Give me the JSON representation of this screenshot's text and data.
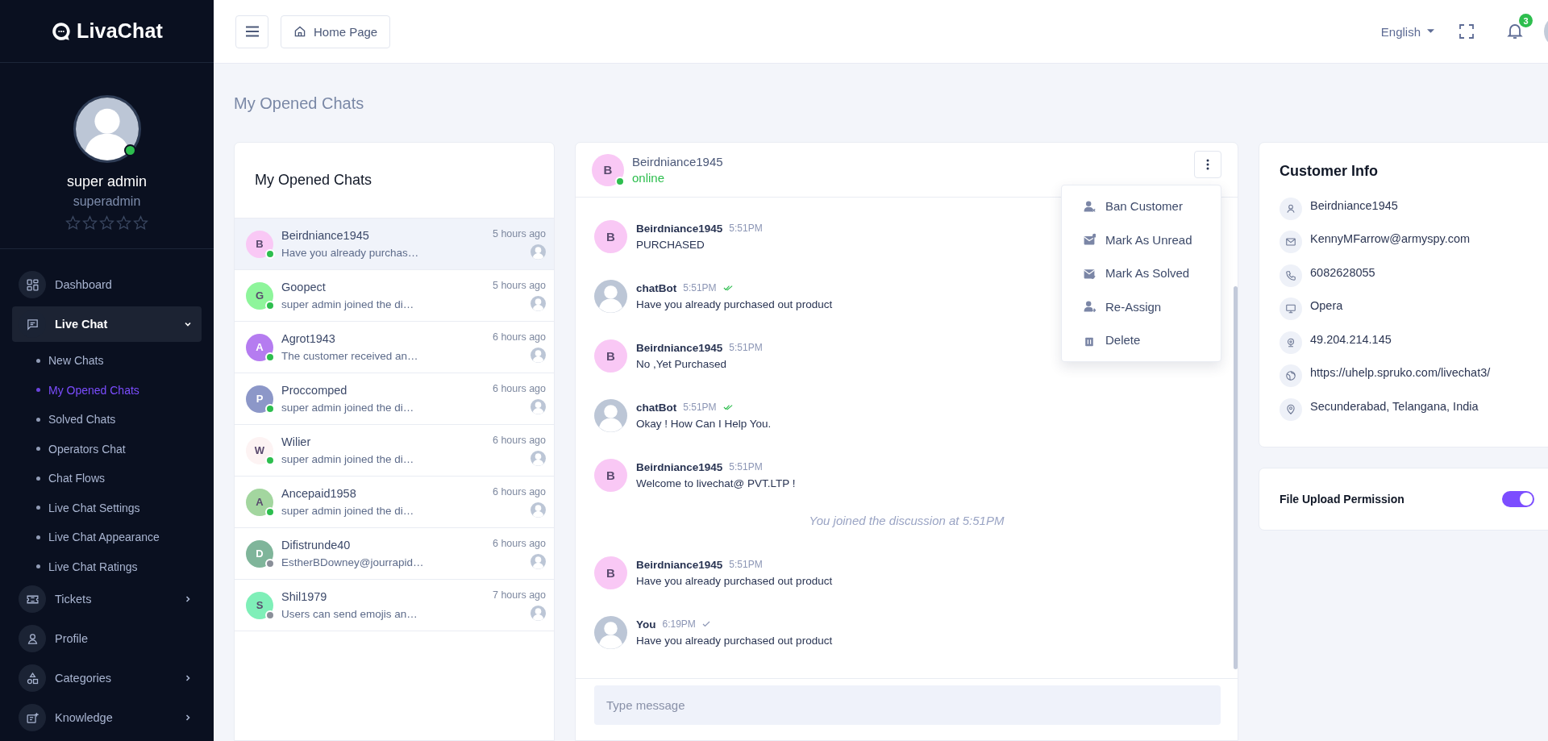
{
  "brand": {
    "name": "LivaChat"
  },
  "sidebar": {
    "user": {
      "name": "super admin",
      "username": "superadmin",
      "online": true,
      "stars": 0
    },
    "menu": [
      {
        "label": "Dashboard",
        "selected": false
      },
      {
        "label": "Live Chat",
        "selected": true,
        "expanded": true,
        "children": [
          {
            "label": "New Chats",
            "selected": false
          },
          {
            "label": "My Opened Chats",
            "selected": true
          },
          {
            "label": "Solved Chats",
            "selected": false
          },
          {
            "label": "Operators Chat",
            "selected": false
          },
          {
            "label": "Chat Flows",
            "selected": false
          },
          {
            "label": "Live Chat Settings",
            "selected": false
          },
          {
            "label": "Live Chat Appearance",
            "selected": false
          },
          {
            "label": "Live Chat Ratings",
            "selected": false
          }
        ]
      },
      {
        "label": "Tickets",
        "selected": false,
        "expanded": false
      },
      {
        "label": "Profile",
        "selected": false
      },
      {
        "label": "Categories",
        "selected": false,
        "expanded": false
      },
      {
        "label": "Knowledge",
        "selected": false,
        "expanded": false
      }
    ]
  },
  "header": {
    "breadcrumb": "Home Page",
    "language": "English",
    "notifications": "3"
  },
  "page_title": "My Opened Chats",
  "chat_list": {
    "title": "My Opened Chats",
    "items": [
      {
        "initial": "B",
        "name": "Beirdniance1945",
        "preview": "Have you already purchas…",
        "time": "5 hours ago",
        "color": "#f9c8f5",
        "online": true,
        "selected": true
      },
      {
        "initial": "G",
        "name": "Goopect",
        "preview": "super admin joined the di…",
        "time": "5 hours ago",
        "color": "#8ef59b",
        "online": true,
        "selected": false
      },
      {
        "initial": "A",
        "name": "Agrot1943",
        "preview": "The customer received an…",
        "time": "6 hours ago",
        "color": "#b57cf0",
        "online": true,
        "selected": false
      },
      {
        "initial": "P",
        "name": "Proccomped",
        "preview": "super admin joined the di…",
        "time": "6 hours ago",
        "color": "#8c97c8",
        "online": true,
        "selected": false
      },
      {
        "initial": "W",
        "name": "Wilier",
        "preview": "super admin joined the di…",
        "time": "6 hours ago",
        "color": "#fdf3f3",
        "online": true,
        "selected": false
      },
      {
        "initial": "A",
        "name": "Ancepaid1958",
        "preview": "super admin joined the di…",
        "time": "6 hours ago",
        "color": "#a3d69f",
        "online": true,
        "selected": false
      },
      {
        "initial": "D",
        "name": "Difistrunde40",
        "preview": "EstherBDowney@jourrapid…",
        "time": "6 hours ago",
        "color": "#7fb59a",
        "online": false,
        "selected": false
      },
      {
        "initial": "S",
        "name": "Shil1979",
        "preview": "Users can send emojis an…",
        "time": "7 hours ago",
        "color": "#7fefb8",
        "online": false,
        "selected": false
      }
    ]
  },
  "conversation": {
    "contact": {
      "initial": "B",
      "name": "Beirdniance1945",
      "status": "online",
      "color": "#f9c8f5",
      "online": true
    },
    "menu_open": true,
    "menu": [
      {
        "label": "Ban Customer"
      },
      {
        "label": "Mark As Unread"
      },
      {
        "label": "Mark As Solved"
      },
      {
        "label": "Re-Assign"
      },
      {
        "label": "Delete"
      }
    ],
    "messages": [
      {
        "kind": "message",
        "initial": "B",
        "sender": "Beirdniance1945",
        "time": "5:51PM",
        "text": "PURCHASED"
      },
      {
        "kind": "message",
        "sender": "chatBot",
        "time": "5:51PM",
        "read": true,
        "text": "Have you already purchased out product"
      },
      {
        "kind": "message",
        "initial": "B",
        "sender": "Beirdniance1945",
        "time": "5:51PM",
        "text": "No ,Yet Purchased"
      },
      {
        "kind": "message",
        "sender": "chatBot",
        "time": "5:51PM",
        "read": true,
        "text": "Okay ! How Can I Help You."
      },
      {
        "kind": "message",
        "initial": "B",
        "sender": "Beirdniance1945",
        "time": "5:51PM",
        "text": "Welcome to livechat@ PVT.LTP !"
      },
      {
        "kind": "system",
        "text": "You joined the discussion at 5:51PM"
      },
      {
        "kind": "message",
        "initial": "B",
        "sender": "Beirdniance1945",
        "time": "5:51PM",
        "text": "Have you already purchased out product"
      },
      {
        "kind": "message",
        "sender": "You",
        "time": "6:19PM",
        "read": false,
        "text": "Have you already purchased out product"
      }
    ],
    "input": {
      "placeholder": "Type message"
    }
  },
  "customer_info": {
    "title": "Customer Info",
    "fields": [
      "Beirdniance1945",
      "KennyMFarrow@armyspy.com",
      "6082628055",
      "Opera",
      "49.204.214.145",
      "https://uhelp.spruko.com/livechat3/",
      "Secunderabad, Telangana, India"
    ]
  },
  "file_upload": {
    "label": "File Upload Permission",
    "on": true
  }
}
